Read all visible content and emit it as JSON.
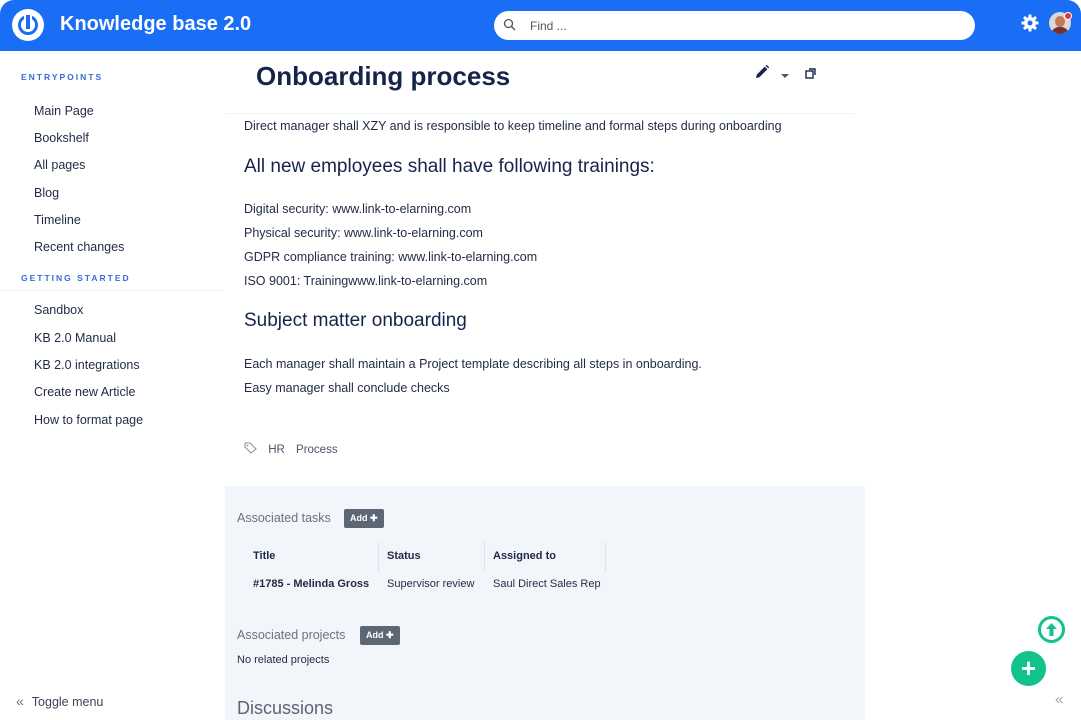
{
  "header": {
    "app_title": "Knowledge base 2.0",
    "search_placeholder": "Find ...",
    "accent_color": "#1a6ef5",
    "icons": [
      "logo-icon",
      "search-icon",
      "gear-icon",
      "user-avatar"
    ]
  },
  "sidebar": {
    "sections": [
      {
        "title": "ENTRYPOINTS",
        "items": [
          "Main Page",
          "Bookshelf",
          "All pages",
          "Blog",
          "Timeline",
          "Recent changes"
        ]
      },
      {
        "title": "GETTING STARTED",
        "items": [
          "Sandbox",
          "KB 2.0 Manual",
          "KB 2.0 integrations",
          "Create new Article",
          "How to format page"
        ]
      }
    ],
    "toggle_label": "Toggle menu"
  },
  "page": {
    "title": "Onboarding process",
    "intro": "Direct manager shall XZY and is responsible to keep timeline and formal steps during onboarding",
    "heading_trainings": "All new employees shall have following trainings:",
    "trainings": [
      "Digital security: www.link-to-elarning.com",
      "Physical security: www.link-to-elarning.com",
      "GDPR compliance training: www.link-to-elarning.com",
      "ISO 9001: Trainingwww.link-to-elarning.com"
    ],
    "heading_subject": "Subject matter onboarding",
    "subject_lines": [
      "Each manager shall maintain a Project template describing all steps in onboarding.",
      "Easy manager shall conclude checks"
    ],
    "tags": [
      "HR",
      "Process"
    ]
  },
  "tasks": {
    "label": "Associated tasks",
    "add_label": "Add",
    "columns": [
      "Title",
      "Status",
      "Assigned to"
    ],
    "rows": [
      [
        "#1785 - Melinda Gross",
        "Supervisor review",
        "Saul Direct Sales Rep"
      ]
    ]
  },
  "projects": {
    "label": "Associated projects",
    "add_label": "Add",
    "empty_text": "No related projects"
  },
  "discussions": {
    "label": "Discussions"
  },
  "fab_color": "#12c28c"
}
